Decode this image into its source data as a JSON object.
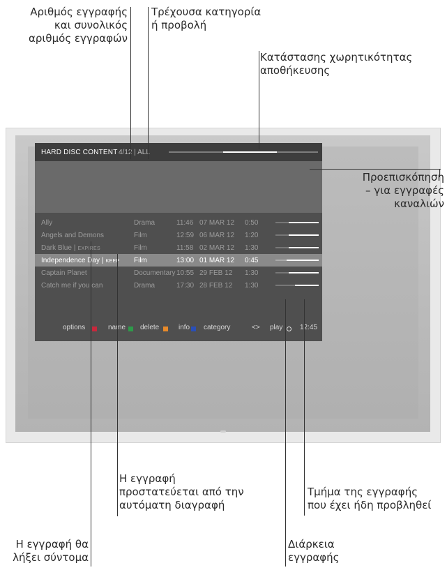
{
  "annotations": {
    "record_number": "Αριθμός εγγραφής\nκαι συνολικός\nαριθμός εγγραφών",
    "current_category": "Τρέχουσα κατηγορία\nή προβολή",
    "storage_capacity": "Κατάστασης χωρητικότητας\nαποθήκευσης",
    "preview": "Προεπισκόπηση\n– για εγγραφές\nκαναλιών",
    "protected": "Η εγγραφή\nπροστατεύεται από την\nαυτόματη διαγραφή",
    "watched_part": "Τμήμα της εγγραφής\nπου έχει ήδη προβληθεί",
    "expires_soon": "Η εγγραφή θα\nλήξει σύντομα",
    "duration": "Διάρκεια\nεγγραφής"
  },
  "menu": {
    "title": "HARD DISC CONTENT",
    "count": "4/12",
    "separator": "|",
    "category": "ALL",
    "capacity_used_fraction": 0.36,
    "recordings": [
      {
        "name": "Ally",
        "tag": "",
        "category": "Drama",
        "time": "11:46",
        "date": "07 MAR 12",
        "duration": "0:50",
        "watched_fraction": 0.3,
        "selected": false
      },
      {
        "name": "Angels and Demons",
        "tag": "",
        "category": "Film",
        "time": "12:59",
        "date": "06 MAR 12",
        "duration": "1:20",
        "watched_fraction": 0.3,
        "selected": false
      },
      {
        "name": "Dark Blue",
        "tag": "EXPIRES",
        "category": "Film",
        "time": "11:58",
        "date": "02 MAR 12",
        "duration": "1:30",
        "watched_fraction": 0.3,
        "selected": false
      },
      {
        "name": "Independence Day",
        "tag": "KEEP",
        "category": "Film",
        "time": "13:00",
        "date": "01 MAR 12",
        "duration": "0:45",
        "watched_fraction": 0.25,
        "selected": true
      },
      {
        "name": "Captain Planet",
        "tag": "",
        "category": "Documentary",
        "time": "10:55",
        "date": "29 FEB 12",
        "duration": "1:30",
        "watched_fraction": 0.3,
        "selected": false
      },
      {
        "name": "Catch me if you can",
        "tag": "",
        "category": "Drama",
        "time": "17:30",
        "date": "28 FEB 12",
        "duration": "1:30",
        "watched_fraction": 0.45,
        "selected": false
      }
    ],
    "footer": {
      "options": "options",
      "name": "name",
      "delete": "delete",
      "info": "info",
      "category": "category",
      "category_arrows": "<>",
      "play": "play",
      "clock": "12:45"
    },
    "colors": {
      "red": "#c8283c",
      "green": "#2e9a4a",
      "orange": "#e88a2a",
      "blue": "#2a4fb8"
    }
  }
}
